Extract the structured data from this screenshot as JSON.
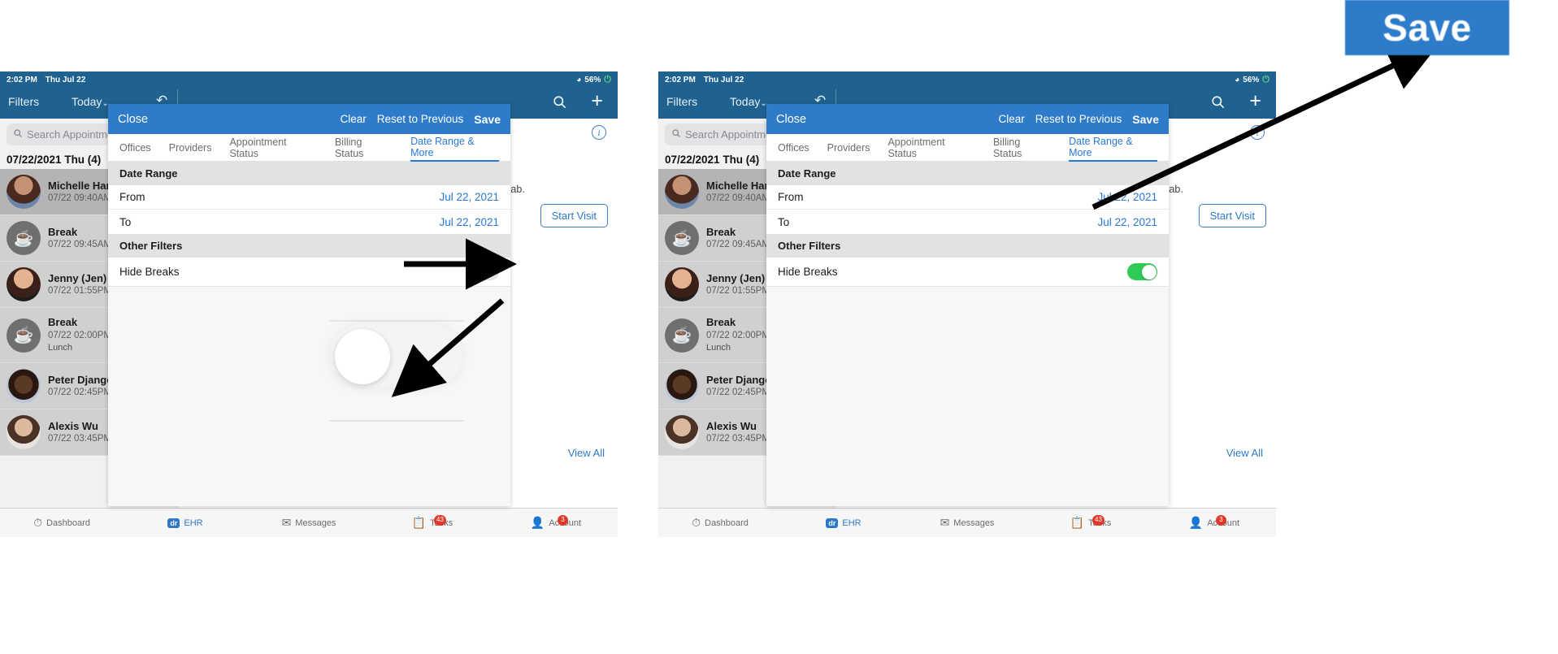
{
  "status_bar": {
    "time": "2:02 PM",
    "date": "Thu Jul 22",
    "wifi_icon": "wifi-icon",
    "battery_percent": "56%",
    "battery_icon": "battery-charging-icon"
  },
  "nav_bar": {
    "filters_label": "Filters",
    "today_label": "Today",
    "chevron": "⌄",
    "refresh_icon": "refresh-icon",
    "search_icon": "search-icon",
    "add_icon": "plus-icon"
  },
  "sidebar": {
    "search_placeholder": "Search Appointments",
    "search_icon": "magnifier-icon",
    "day_header": "07/22/2021 Thu (4)",
    "appointments": [
      {
        "name": "Michelle Harris",
        "time": "07/22 09:40AM",
        "sub": "",
        "type": "patient",
        "selected": true
      },
      {
        "name": "Break",
        "time": "07/22 09:45AM",
        "sub": "",
        "type": "break",
        "selected": false
      },
      {
        "name": "Jenny (Jen) Ha",
        "time": "07/22 01:55PM",
        "sub": "",
        "type": "patient",
        "selected": false
      },
      {
        "name": "Break",
        "time": "07/22 02:00PM",
        "sub": "Lunch",
        "type": "break",
        "selected": false
      },
      {
        "name": "Peter Django",
        "time": "07/22 02:45PM",
        "sub": "",
        "type": "patient",
        "selected": false
      },
      {
        "name": "Alexis Wu",
        "time": "07/22 03:45PM",
        "sub": "",
        "type": "patient",
        "selected": false
      }
    ]
  },
  "content": {
    "info_icon": "info-icon",
    "tab_hint": "t tab.",
    "start_visit_label": "Start Visit",
    "view_all_label": "View All"
  },
  "tabbar": {
    "items": [
      {
        "label": "Dashboard",
        "icon": "speedometer-icon",
        "badge": "",
        "active": false
      },
      {
        "label": "EHR",
        "icon": "dr-chip-icon",
        "badge": "",
        "active": true
      },
      {
        "label": "Messages",
        "icon": "envelope-icon",
        "badge": "",
        "active": false
      },
      {
        "label": "Tasks",
        "icon": "clipboard-icon",
        "badge": "43",
        "active": false
      },
      {
        "label": "Account",
        "icon": "account-icon",
        "badge": "3",
        "active": false
      }
    ]
  },
  "modal": {
    "close_label": "Close",
    "clear_label": "Clear",
    "reset_label": "Reset to Previous",
    "save_label": "Save",
    "tabs": [
      {
        "label": "Offices",
        "active": false
      },
      {
        "label": "Providers",
        "active": false
      },
      {
        "label": "Appointment Status",
        "active": false
      },
      {
        "label": "Billing Status",
        "active": false
      },
      {
        "label": "Date Range & More",
        "active": true
      }
    ],
    "date_range_header": "Date Range",
    "from_label": "From",
    "from_value": "Jul 22, 2021",
    "to_label": "To",
    "to_value": "Jul 22, 2021",
    "other_filters_header": "Other Filters",
    "hide_breaks_label": "Hide Breaks",
    "hide_breaks_state_before": "off",
    "hide_breaks_state_after": "on"
  },
  "annotation": {
    "save_callout_label": "Save",
    "callout_color": "#2e7cc9",
    "arrow_color": "#000000",
    "toggle_on_color": "#2fcb57"
  }
}
